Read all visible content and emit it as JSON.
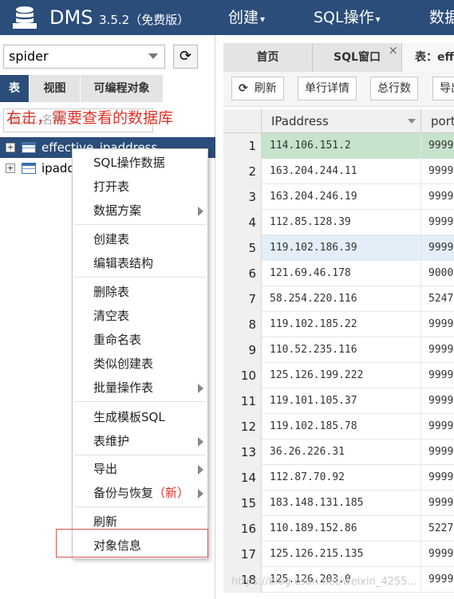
{
  "header": {
    "brand": "DMS",
    "version": "3.5.2（免费版）",
    "nav": [
      {
        "label": "创建",
        "has_dropdown": true
      },
      {
        "label": "SQL操作",
        "has_dropdown": true
      },
      {
        "label": "数据"
      }
    ],
    "logo_icon": "database-stack-icon",
    "bg_color": "#2a4d7a"
  },
  "left": {
    "database_select": {
      "value": "spider"
    },
    "refresh_icon": "refresh-icon",
    "tabs": [
      "表",
      "视图",
      "可编程对象"
    ],
    "active_tab": 0,
    "filter_placeholder": "输入...名称",
    "annotation": "右击，需要查看的数据库",
    "tree": [
      {
        "name": "effective_ipaddress",
        "selected": true
      },
      {
        "name": "ipaddress",
        "selected": false
      }
    ]
  },
  "context_menu": {
    "groups": [
      [
        {
          "label": "SQL操作数据"
        },
        {
          "label": "打开表"
        },
        {
          "label": "数据方案",
          "submenu": true
        }
      ],
      [
        {
          "label": "创建表"
        },
        {
          "label": "编辑表结构"
        }
      ],
      [
        {
          "label": "删除表"
        },
        {
          "label": "清空表"
        },
        {
          "label": "重命名表"
        },
        {
          "label": "类似创建表"
        },
        {
          "label": "批量操作表",
          "submenu": true
        }
      ],
      [
        {
          "label": "生成模板SQL"
        },
        {
          "label": "表维护",
          "submenu": true
        }
      ],
      [
        {
          "label": "导出",
          "submenu": true
        },
        {
          "label": "备份与恢复",
          "badge": "（新）",
          "submenu": true
        }
      ],
      [
        {
          "label": "刷新"
        },
        {
          "label": "对象信息",
          "highlighted": true
        }
      ]
    ],
    "highlight_color": "#d9534f"
  },
  "right": {
    "tabs": [
      {
        "label": "首页"
      },
      {
        "label": "SQL窗口",
        "closable": true
      },
      {
        "label": "表：effective_ipaddress",
        "active": true
      }
    ],
    "toolbar": [
      {
        "label": "刷新",
        "icon": "refresh-icon"
      },
      {
        "label": "单行详情"
      },
      {
        "label": "总行数"
      },
      {
        "label": "导出"
      }
    ],
    "grid": {
      "columns": [
        "IPaddress",
        "port"
      ],
      "rows": [
        {
          "n": "1",
          "ip": "114.106.151.2",
          "port": "9999",
          "selected": true
        },
        {
          "n": "2",
          "ip": "163.204.244.11",
          "port": "9999"
        },
        {
          "n": "3",
          "ip": "163.204.246.19",
          "port": "9999"
        },
        {
          "n": "4",
          "ip": "112.85.128.39",
          "port": "9999"
        },
        {
          "n": "5",
          "ip": "119.102.186.39",
          "port": "9999",
          "hover": true
        },
        {
          "n": "6",
          "ip": "121.69.46.178",
          "port": "9000"
        },
        {
          "n": "7",
          "ip": "58.254.220.116",
          "port": "5247"
        },
        {
          "n": "8",
          "ip": "119.102.185.22",
          "port": "9999"
        },
        {
          "n": "9",
          "ip": "110.52.235.116",
          "port": "9999"
        },
        {
          "n": "10",
          "ip": "125.126.199.222",
          "port": "9999"
        },
        {
          "n": "11",
          "ip": "119.101.105.37",
          "port": "9999"
        },
        {
          "n": "12",
          "ip": "119.102.185.78",
          "port": "9999"
        },
        {
          "n": "13",
          "ip": "36.26.226.31",
          "port": "9999"
        },
        {
          "n": "14",
          "ip": "112.87.70.92",
          "port": "9999"
        },
        {
          "n": "15",
          "ip": "183.148.131.185",
          "port": "9999"
        },
        {
          "n": "16",
          "ip": "110.189.152.86",
          "port": "5227"
        },
        {
          "n": "17",
          "ip": "125.126.215.135",
          "port": "9999"
        },
        {
          "n": "18",
          "ip": "125.126.203.0",
          "port": "9999"
        }
      ],
      "selected_row_color": "#c7e3cc",
      "hover_row_color": "#e3eef9"
    }
  },
  "watermark": "https://blog.csdn.net/weixin_4255..."
}
